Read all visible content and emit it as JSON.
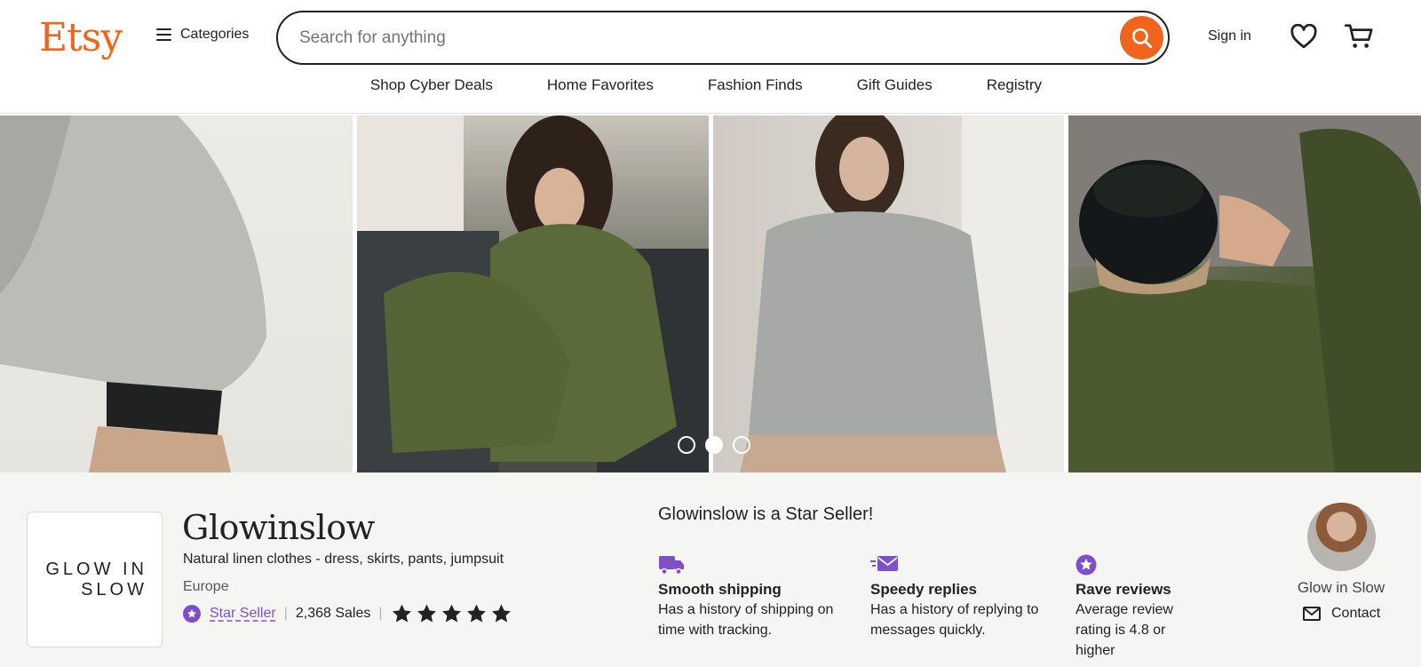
{
  "header": {
    "logo": "Etsy",
    "categories_label": "Categories",
    "search_placeholder": "Search for anything",
    "sign_in": "Sign in",
    "icons": [
      "search-icon",
      "heart-icon",
      "cart-icon",
      "hamburger-icon"
    ]
  },
  "nav": {
    "items": [
      "Shop Cyber Deals",
      "Home Favorites",
      "Fashion Finds",
      "Gift Guides",
      "Registry"
    ]
  },
  "hero": {
    "slide_count": 3,
    "active_slide": 2
  },
  "shop": {
    "logo_line1": "GLOW IN",
    "logo_line2": "SLOW",
    "name": "Glowinslow",
    "tagline": "Natural linen clothes - dress, skirts, pants, jumpsuit",
    "location": "Europe",
    "star_seller_label": "Star Seller",
    "sales": "2,368 Sales",
    "rating_stars": 5
  },
  "star_seller": {
    "heading": "Glowinslow is a Star Seller!",
    "badges": [
      {
        "title": "Smooth shipping",
        "text": "Has a history of shipping on time with tracking.",
        "icon": "truck-icon"
      },
      {
        "title": "Speedy replies",
        "text": "Has a history of replying to messages quickly.",
        "icon": "envelope-fast-icon"
      },
      {
        "title": "Rave reviews",
        "text": "Average review rating is 4.8 or higher",
        "icon": "star-badge-icon"
      }
    ]
  },
  "owner": {
    "name": "Glow in Slow",
    "contact_label": "Contact"
  },
  "colors": {
    "brand": "#f1641e",
    "star_seller": "#7f4fc9",
    "background_panel": "#f5f5f4"
  }
}
